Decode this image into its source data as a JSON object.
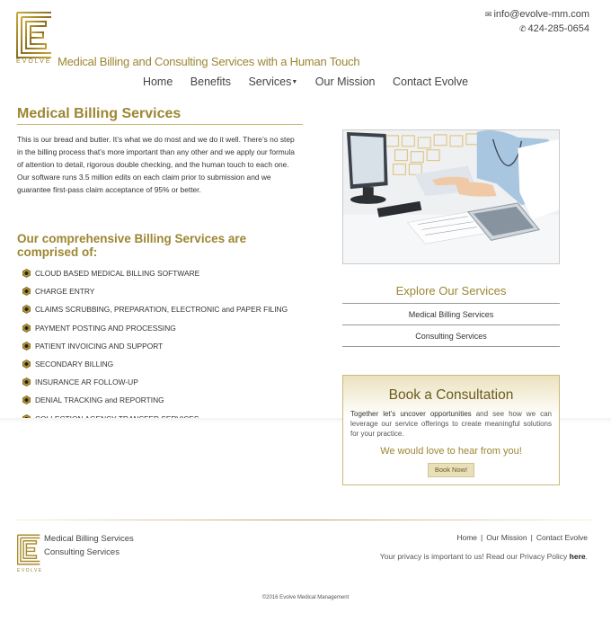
{
  "header": {
    "logo_word": "EVOLVE",
    "tagline": "Medical Billing and Consulting Services with a Human Touch",
    "email": "info@evolve-mm.com",
    "phone": "424-285-0654"
  },
  "nav": {
    "items": [
      "Home",
      "Benefits",
      "Services",
      "Our Mission",
      "Contact Evolve"
    ]
  },
  "billing": {
    "title": "Medical Billing Services",
    "intro": "This is our bread and butter. It’s what we do most and we do it well. There’s no step in the billing process that’s more important than any other and we apply our formula of attention to detail, rigorous double checking, and the human touch to each one. Our software runs 3.5 million edits on each claim prior to submission and we guarantee first-pass claim acceptance of 95% or better.",
    "list_title": "Our comprehensive Billing Services are comprised of:",
    "services": [
      "CLOUD BASED MEDICAL BILLING SOFTWARE",
      "CHARGE ENTRY",
      "CLAIMS SCRUBBING, PREPARATION, ELECTRONIC and PAPER FILING",
      "PAYMENT POSTING AND PROCESSING",
      "PATIENT INVOICING AND SUPPORT",
      "SECONDARY BILLING",
      "INSURANCE AR FOLLOW-UP",
      "DENIAL TRACKING and REPORTING",
      "COLLECTION AGENCY TRANSFER SERVICES"
    ]
  },
  "explore": {
    "title": "Explore Our Services",
    "items": [
      "Medical Billing Services",
      "Consulting Services"
    ]
  },
  "book": {
    "title": "Book a Consultation",
    "text_bold": "Together let’s uncover opportunities",
    "text_rest": " and see how we can leverage our service offerings to create meaningful solutions for your practice.",
    "love": "We would love to hear from you!",
    "button": "Book Now!"
  },
  "footer": {
    "logo_word": "EVOLVE",
    "links": [
      "Medical Billing Services",
      "Consulting Services"
    ],
    "nav": [
      "Home",
      "Our Mission",
      "Contact Evolve"
    ],
    "privacy_text": "Your privacy is important to us! Read our Privacy Policy ",
    "privacy_link": "here",
    "privacy_end": ".",
    "copyright": "©2016 Evolve Medical Management"
  },
  "colors": {
    "accent_gold": "#9c8632",
    "text": "#333333"
  }
}
